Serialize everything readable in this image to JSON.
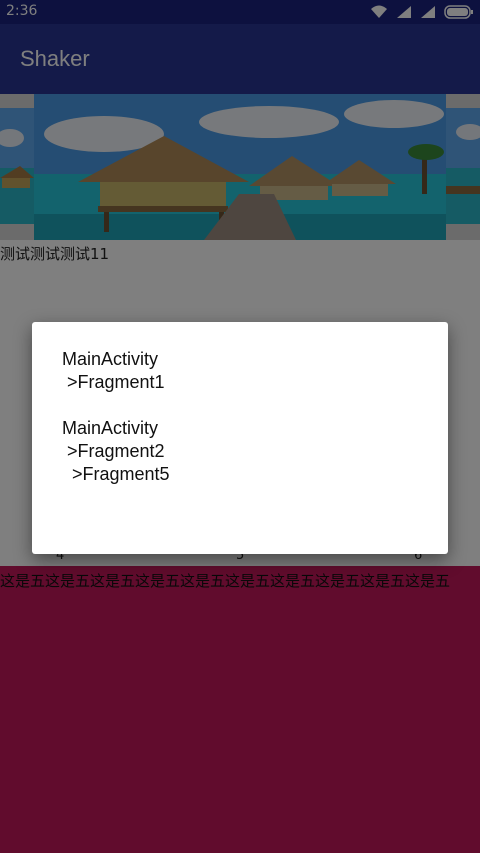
{
  "status_bar": {
    "time": "2:36",
    "icons": [
      "wifi-icon",
      "signal-icon",
      "signal-icon-2",
      "battery-icon"
    ]
  },
  "app_bar": {
    "title": "Shaker"
  },
  "content": {
    "test_label": "测试测试测试11",
    "numbers": [
      "4",
      "5",
      "6"
    ],
    "repeat_text": "这是五这是五这是五这是五这是五这是五这是五这是五这是五这是五"
  },
  "dialog": {
    "lines": [
      "MainActivity",
      " >Fragment1",
      "",
      "MainActivity",
      " >Fragment2",
      "  >Fragment5"
    ]
  },
  "colors": {
    "status_bar": "#1a237e",
    "app_bar": "#283593",
    "red_area": "#c2185b",
    "sea": "#26c6da",
    "sky": "#4a9ae6"
  }
}
